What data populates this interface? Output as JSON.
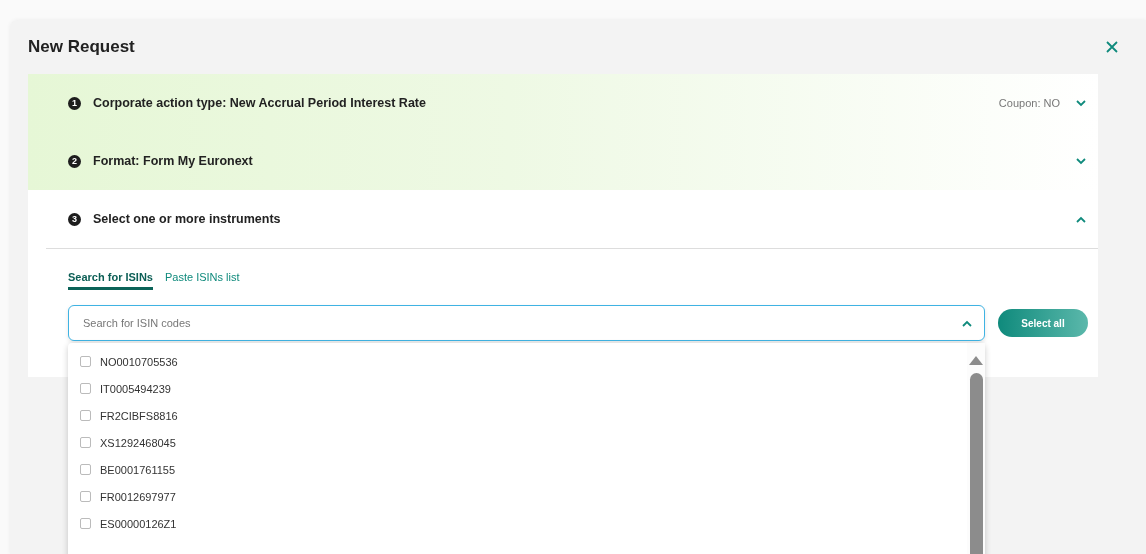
{
  "dialog": {
    "title": "New Request"
  },
  "steps": [
    {
      "number": "1",
      "title": "Corporate action type: New Accrual Period Interest Rate",
      "summary": "Coupon: NO",
      "completed": true,
      "expanded": false
    },
    {
      "number": "2",
      "title": "Format: Form My Euronext",
      "completed": true,
      "expanded": false
    },
    {
      "number": "3",
      "title": "Select one or more instruments",
      "completed": false,
      "expanded": true
    }
  ],
  "tabs": [
    {
      "label": "Search for ISINs",
      "selected": true
    },
    {
      "label": "Paste ISINs list",
      "selected": false
    }
  ],
  "search": {
    "placeholder": "Search for ISIN codes",
    "expanded": true
  },
  "select_all_button": "Select all",
  "isin_options": [
    {
      "code": "NO0010705536",
      "checked": false
    },
    {
      "code": "IT0005494239",
      "checked": false
    },
    {
      "code": "FR2CIBFS8816",
      "checked": false
    },
    {
      "code": "XS1292468045",
      "checked": false
    },
    {
      "code": "BE0001761155",
      "checked": false
    },
    {
      "code": "FR0012697977",
      "checked": false
    },
    {
      "code": "ES00000126Z1",
      "checked": false
    }
  ]
}
